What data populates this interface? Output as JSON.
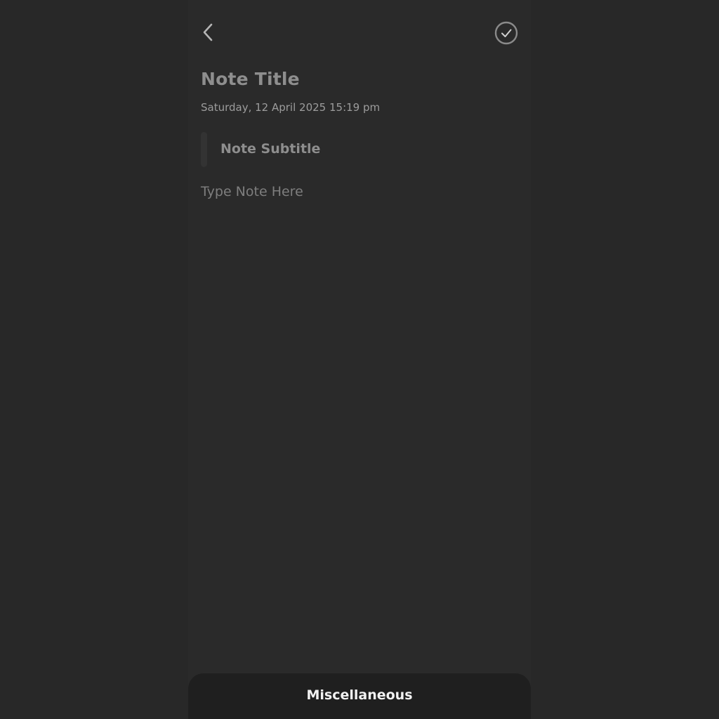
{
  "header": {
    "back_icon": "chevron-left-icon",
    "save_icon": "check-circle-icon"
  },
  "note": {
    "title_placeholder": "Note Title",
    "date_time": "Saturday, 12 April 2025 15:19 pm",
    "subtitle_placeholder": "Note Subtitle",
    "body_placeholder": "Type Note Here"
  },
  "bottom_sheet": {
    "label": "Miscellaneous"
  },
  "colors": {
    "background": "#282828",
    "screen": "#2a2a2a",
    "sheet": "#1f1f1f",
    "placeholder": "#8e8e8e",
    "sheet_text": "#f2f2f2"
  }
}
